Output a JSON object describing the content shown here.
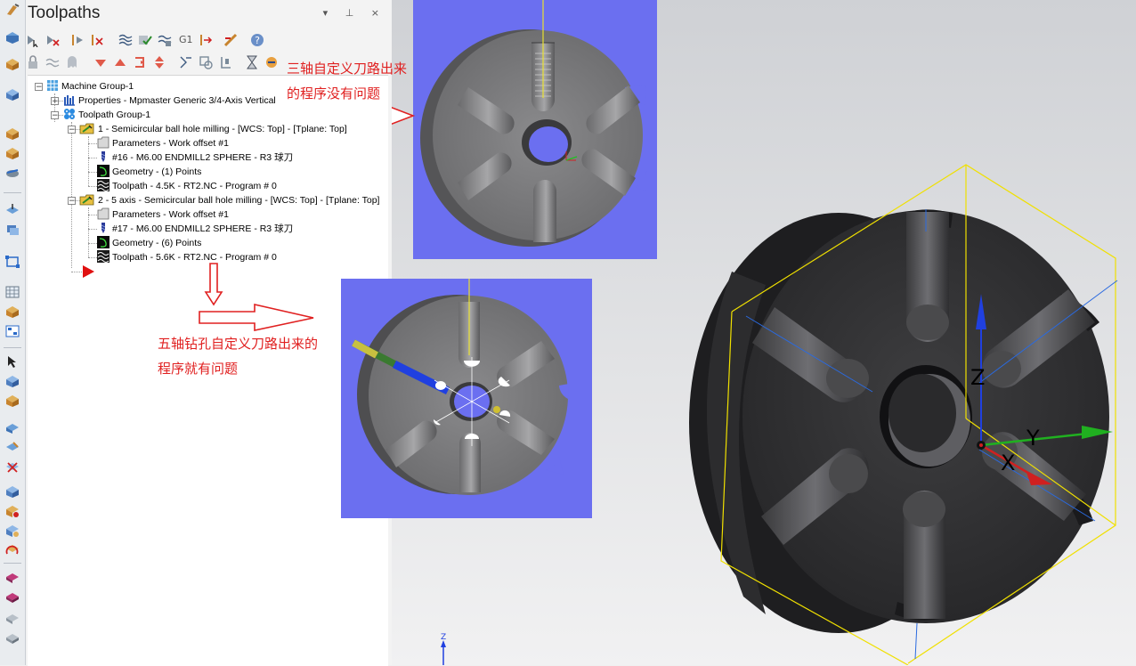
{
  "panel": {
    "title": "Toolpaths",
    "controls": "▾ ⊥ ×"
  },
  "tree": {
    "machine_group": "Machine Group-1",
    "properties": "Properties - Mpmaster Generic 3/4-Axis Vertical",
    "toolpath_group": "Toolpath Group-1",
    "op1": {
      "title": "1 - Semicircular ball hole milling - [WCS: Top] - [Tplane: Top]",
      "parameters": "Parameters - Work offset #1",
      "tool": "#16 - M6.00 ENDMILL2 SPHERE - R3 球刀",
      "geometry": "Geometry - (1) Points",
      "toolpath": "Toolpath - 4.5K - RT2.NC - Program # 0"
    },
    "op2": {
      "title": "2 - 5 axis - Semicircular ball hole milling - [WCS: Top] - [Tplane: Top]",
      "parameters": "Parameters - Work offset #1",
      "tool": "#17 - M6.00 ENDMILL2 SPHERE - R3 球刀",
      "geometry": "Geometry - (6) Points",
      "toolpath": "Toolpath - 5.6K - RT2.NC - Program # 0"
    }
  },
  "annotations": {
    "three_axis_line1": "三轴自定义刀路出来",
    "three_axis_line2": "的程序没有问题",
    "five_axis_line1": "五轴钻孔自定义刀路出来的",
    "five_axis_line2": "程序就有问题"
  },
  "viewport": {
    "axis_z": "Z",
    "axis_y": "Y",
    "axis_x": "X",
    "corner_z": "Z"
  },
  "colors": {
    "annotation_red": "#e02020",
    "inset_background": "#6b6ff0",
    "bounding_box": "#f0e000",
    "axis_x": "#d02020",
    "axis_y": "#20b020",
    "axis_z": "#2040e0"
  },
  "icons": {
    "left_toolbar": [
      "toolpath-icon",
      "wireframe-icon",
      "solid-icon",
      "machine-icon",
      "shade-icon",
      "cube-icon",
      "cube-icon",
      "chamfer-icon",
      "move-icon",
      "layer-icon",
      "select-icon",
      "grid-icon",
      "cube-icon",
      "cube-icon",
      "cube-icon",
      "cube-icon",
      "cube-icon",
      "cube-icon",
      "cube-icon",
      "cube-icon",
      "cube-icon",
      "cube-icon",
      "cube-icon",
      "cube-icon",
      "cube-icon",
      "cube-icon"
    ]
  }
}
